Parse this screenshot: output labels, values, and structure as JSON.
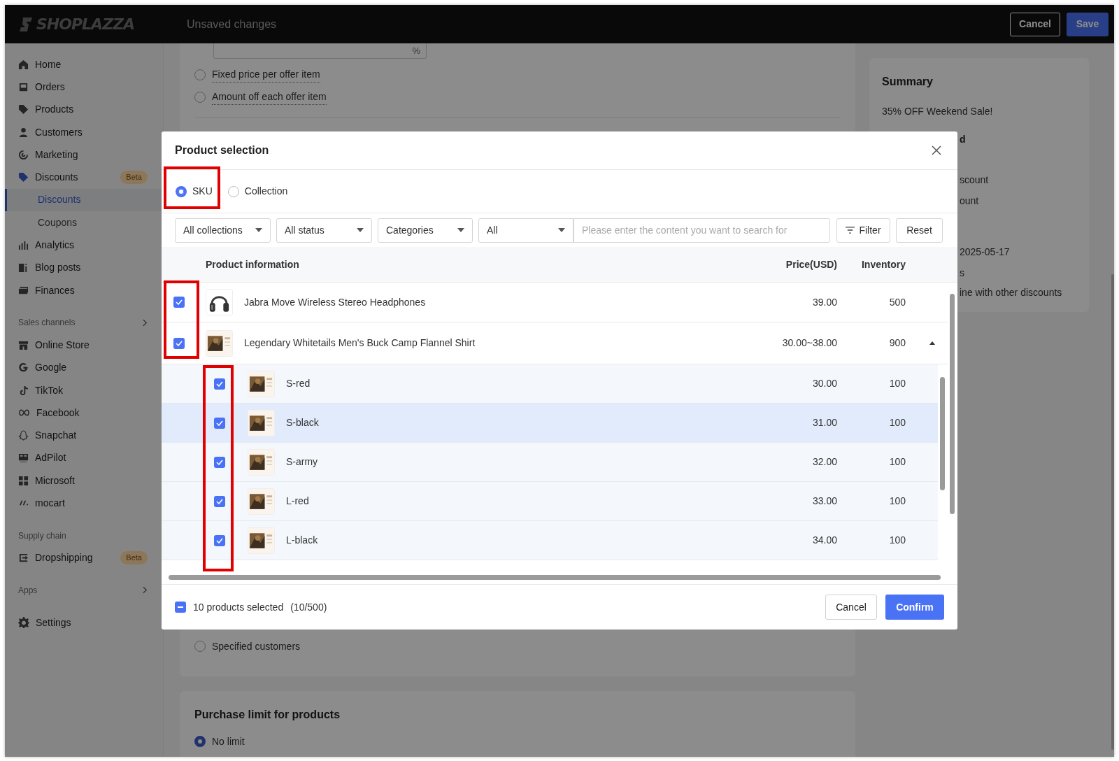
{
  "header": {
    "brand": "SHOPLAZZA",
    "title": "Unsaved changes",
    "buttons": [
      {
        "label": "Cancel",
        "kind": "outline"
      },
      {
        "label": "Save",
        "kind": "primary"
      }
    ]
  },
  "sidebar": {
    "sections": [
      {
        "items": [
          {
            "label": "Home",
            "selected": false
          },
          {
            "label": "Orders",
            "selected": false
          },
          {
            "label": "Products",
            "selected": false
          },
          {
            "label": "Customers",
            "selected": false
          },
          {
            "label": "Marketing",
            "selected": false
          },
          {
            "label": "Discounts",
            "selected": false,
            "badge": "Beta",
            "children": [
              {
                "label": "Discounts",
                "selected": true
              },
              {
                "label": "Coupons",
                "selected": false
              }
            ]
          },
          {
            "label": "Analytics",
            "selected": false
          },
          {
            "label": "Blog posts",
            "selected": false
          },
          {
            "label": "Finances",
            "selected": false
          }
        ]
      },
      {
        "heading": "Sales channels",
        "collapsible": true,
        "items": [
          {
            "label": "Online Store",
            "selected": false
          },
          {
            "label": "Google",
            "selected": false
          },
          {
            "label": "TikTok",
            "selected": false
          },
          {
            "label": "Facebook",
            "selected": false
          },
          {
            "label": "Snapchat",
            "selected": false
          },
          {
            "label": "AdPilot",
            "selected": false
          },
          {
            "label": "Microsoft",
            "selected": false
          },
          {
            "label": "mocart",
            "selected": false
          }
        ]
      },
      {
        "heading": "Supply chain",
        "collapsible": false,
        "items": [
          {
            "label": "Dropshipping",
            "selected": false,
            "badge": "Beta"
          }
        ]
      },
      {
        "heading": "Apps",
        "collapsible": true
      },
      {
        "items": [
          {
            "label": "Settings",
            "selected": false
          }
        ]
      }
    ]
  },
  "page": {
    "rate_field": {
      "suffix": "%"
    },
    "offer_options": [
      {
        "label": "Fixed price per offer item",
        "selected": false
      },
      {
        "label": "Amount off each offer item",
        "selected": false
      }
    ],
    "customer_option": {
      "label": "Specified customers",
      "selected": false
    },
    "purchase_limit": {
      "title": "Purchase limit for products",
      "options": [
        {
          "label": "No limit",
          "selected": true
        }
      ]
    }
  },
  "summary": {
    "title": "Summary",
    "lines": [
      {
        "text": "35% OFF Weekend Sale!",
        "kind": "text"
      },
      {
        "text": "d",
        "kind": "heading"
      },
      {
        "text": "scount",
        "kind": "text"
      },
      {
        "text": "ount",
        "kind": "text"
      },
      {
        "text": "2025-05-17",
        "kind": "text"
      },
      {
        "text": "s",
        "kind": "text"
      },
      {
        "text": "ine with other discounts",
        "kind": "text"
      }
    ]
  },
  "dialog": {
    "title": "Product selection",
    "modes": [
      {
        "label": "SKU",
        "selected": true
      },
      {
        "label": "Collection",
        "selected": false
      }
    ],
    "filters": [
      "All collections",
      "All status",
      "Categories",
      "All"
    ],
    "search": {
      "placeholder": "Please enter the content you want to search for"
    },
    "filter_button": "Filter",
    "reset_button": "Reset",
    "table": {
      "columns": [
        "Product information",
        "Price(USD)",
        "Inventory"
      ],
      "rows": [
        {
          "name": "Jabra Move Wireless Stereo Headphones",
          "price": "39.00",
          "inventory": "500",
          "checked": true
        },
        {
          "name": "Legendary Whitetails Men's Buck Camp Flannel Shirt",
          "price": "30.00~38.00",
          "inventory": "900",
          "checked": true,
          "expanded": true,
          "children": [
            {
              "name": "S-red",
              "price": "30.00",
              "inventory": "100",
              "checked": true,
              "hovered": false
            },
            {
              "name": "S-black",
              "price": "31.00",
              "inventory": "100",
              "checked": true,
              "hovered": true
            },
            {
              "name": "S-army",
              "price": "32.00",
              "inventory": "100",
              "checked": true,
              "hovered": false
            },
            {
              "name": "L-red",
              "price": "33.00",
              "inventory": "100",
              "checked": true,
              "hovered": false
            },
            {
              "name": "L-black",
              "price": "34.00",
              "inventory": "100",
              "checked": true,
              "hovered": false
            }
          ]
        }
      ]
    },
    "footer": {
      "selection": "10 products selected",
      "count": "(10/500)",
      "indeterminate": true,
      "buttons": [
        {
          "label": "Cancel",
          "kind": "outline"
        },
        {
          "label": "Confirm",
          "kind": "primary"
        }
      ]
    }
  }
}
